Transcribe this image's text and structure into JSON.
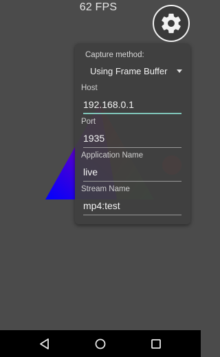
{
  "fps_text": "62 FPS",
  "icons": {
    "settings": "gear-icon",
    "back": "back-triangle-icon",
    "home": "home-circle-icon",
    "recents": "recents-square-icon",
    "dropdown": "caret-down-icon"
  },
  "settings_panel": {
    "capture_label": "Capture method:",
    "capture_value": "Using Frame Buffer",
    "fields": [
      {
        "label": "Host",
        "value": "192.168.0.1",
        "focused": true
      },
      {
        "label": "Port",
        "value": "1935",
        "focused": false
      },
      {
        "label": "Application Name",
        "value": "live",
        "focused": false
      },
      {
        "label": "Stream Name",
        "value": "mp4:test",
        "focused": false
      }
    ]
  },
  "colors": {
    "background": "#4b4b4b",
    "panel": "#404040",
    "focus_accent": "#7fc4b8",
    "triangle_red": "#ff0000",
    "triangle_green": "#00c000",
    "triangle_blue": "#0000ff",
    "circle": "#c83232"
  }
}
